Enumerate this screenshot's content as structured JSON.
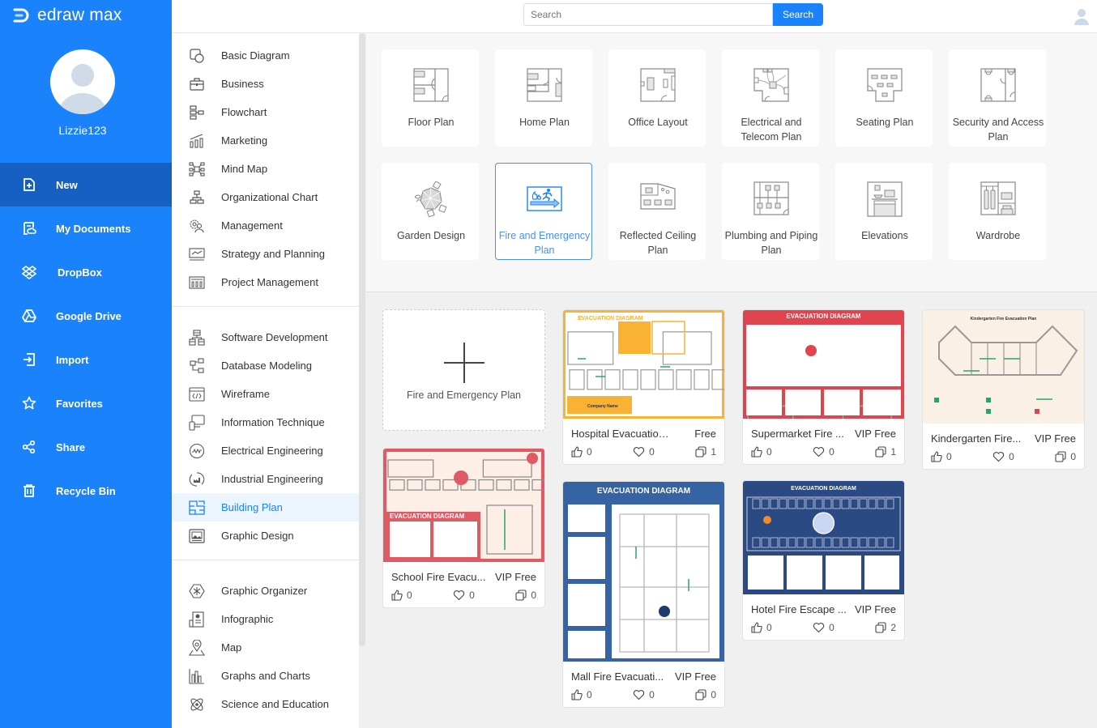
{
  "app": {
    "logo_text": "edraw max"
  },
  "user": {
    "name": "Lizzie123"
  },
  "sidebar": {
    "items": [
      {
        "label": "New",
        "icon": "new-file-icon",
        "active": true
      },
      {
        "label": "My Documents",
        "icon": "documents-icon"
      },
      {
        "label": "DropBox",
        "icon": "dropbox-icon"
      },
      {
        "label": "Google Drive",
        "icon": "google-drive-icon"
      },
      {
        "label": "Import",
        "icon": "import-icon"
      },
      {
        "label": "Favorites",
        "icon": "star-icon"
      },
      {
        "label": "Share",
        "icon": "share-icon"
      },
      {
        "label": "Recycle Bin",
        "icon": "trash-icon"
      }
    ]
  },
  "search": {
    "placeholder": "Search",
    "button_label": "Search"
  },
  "categories": {
    "group1": [
      {
        "label": "Basic Diagram"
      },
      {
        "label": "Business"
      },
      {
        "label": "Flowchart"
      },
      {
        "label": "Marketing"
      },
      {
        "label": "Mind Map"
      },
      {
        "label": "Organizational Chart"
      },
      {
        "label": "Management"
      },
      {
        "label": "Strategy and Planning"
      },
      {
        "label": "Project Management"
      }
    ],
    "group2": [
      {
        "label": "Software Development"
      },
      {
        "label": "Database Modeling"
      },
      {
        "label": "Wireframe"
      },
      {
        "label": "Information Technique"
      },
      {
        "label": "Electrical Engineering"
      },
      {
        "label": "Industrial Engineering"
      },
      {
        "label": "Building Plan",
        "active": true
      },
      {
        "label": "Graphic Design"
      }
    ],
    "group3": [
      {
        "label": "Graphic Organizer"
      },
      {
        "label": "Infographic"
      },
      {
        "label": "Map"
      },
      {
        "label": "Graphs and Charts"
      },
      {
        "label": "Science and Education"
      }
    ]
  },
  "diagram_types": [
    {
      "label": "Floor Plan"
    },
    {
      "label": "Home Plan"
    },
    {
      "label": "Office Layout"
    },
    {
      "label": "Electrical and Telecom Plan"
    },
    {
      "label": "Seating Plan"
    },
    {
      "label": "Security and Access Plan"
    },
    {
      "label": "Garden Design"
    },
    {
      "label": "Fire and Emergency Plan",
      "selected": true
    },
    {
      "label": "Reflected Ceiling Plan"
    },
    {
      "label": "Plumbing and Piping Plan"
    },
    {
      "label": "Elevations"
    },
    {
      "label": "Wardrobe"
    }
  ],
  "blank_template": {
    "label": "Fire and Emergency Plan"
  },
  "templates": [
    {
      "name": "Hospital Evacuation L...",
      "price": "Free",
      "likes": "0",
      "favorites": "0",
      "copies": "1",
      "thumb_title": "EVACUATION DIAGRAM"
    },
    {
      "name": "Supermarket Fire ...",
      "price": "VIP Free",
      "likes": "0",
      "favorites": "0",
      "copies": "1",
      "thumb_title": "EVACUATION DIAGRAM"
    },
    {
      "name": "Kindergarten Fire...",
      "price": "VIP Free",
      "likes": "0",
      "favorites": "0",
      "copies": "0",
      "thumb_title": "Kindergarten Fire Evacuation Plan"
    },
    {
      "name": "School Fire Evacu...",
      "price": "VIP Free",
      "likes": "0",
      "favorites": "0",
      "copies": "0",
      "thumb_title": "EVACUATION   DIAGRAM"
    },
    {
      "name": "Mall Fire Evacuati...",
      "price": "VIP Free",
      "likes": "0",
      "favorites": "0",
      "copies": "0",
      "thumb_title": "EVACUATION DIAGRAM"
    },
    {
      "name": "Hotel Fire Escape ...",
      "price": "VIP Free",
      "likes": "0",
      "favorites": "0",
      "copies": "2",
      "thumb_title": "EVACUATION DIAGRAM"
    }
  ],
  "colors": {
    "brand": "#1a82fb",
    "sidebar_active": "#1560c2",
    "hospital_thumb": "#f9b233",
    "supermarket_thumb": "#e0454f",
    "kindergarten_thumb": "#faf0e6",
    "school_thumb": "#e05a63",
    "mall_thumb": "#3563a3",
    "hotel_thumb": "#2b4a84"
  }
}
